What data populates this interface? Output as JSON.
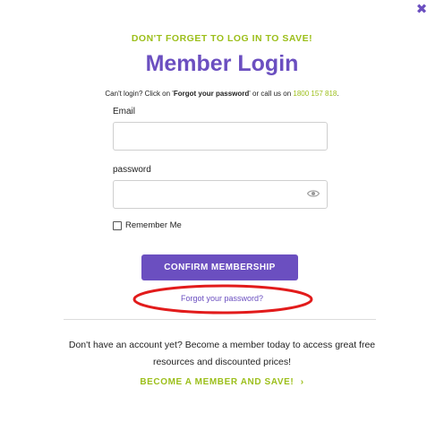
{
  "modal": {
    "close_icon": "close-icon",
    "eyebrow": "DON'T FORGET TO LOG IN TO SAVE!",
    "title": "Member Login",
    "help": {
      "prefix": "Can't login? Click on '",
      "link_text": "Forgot your password",
      "middle": "' or call us on ",
      "phone": "1800 157 818",
      "suffix": "."
    },
    "email_label": "Email",
    "email_value": "",
    "password_label": "password",
    "password_value": "",
    "password_toggle_icon": "eye-icon",
    "remember_label": "Remember Me",
    "confirm_button": "CONFIRM MEMBERSHIP",
    "forgot_link": "Forgot your password?",
    "cta_text": "Don't have an account yet? Become a member today to access great free resources and discounted prices!",
    "become_link": "BECOME A MEMBER AND SAVE!",
    "become_arrow": "›"
  },
  "colors": {
    "accent": "#6b4fc0",
    "green": "#9cbf1b",
    "annotation": "#e21b1b"
  }
}
